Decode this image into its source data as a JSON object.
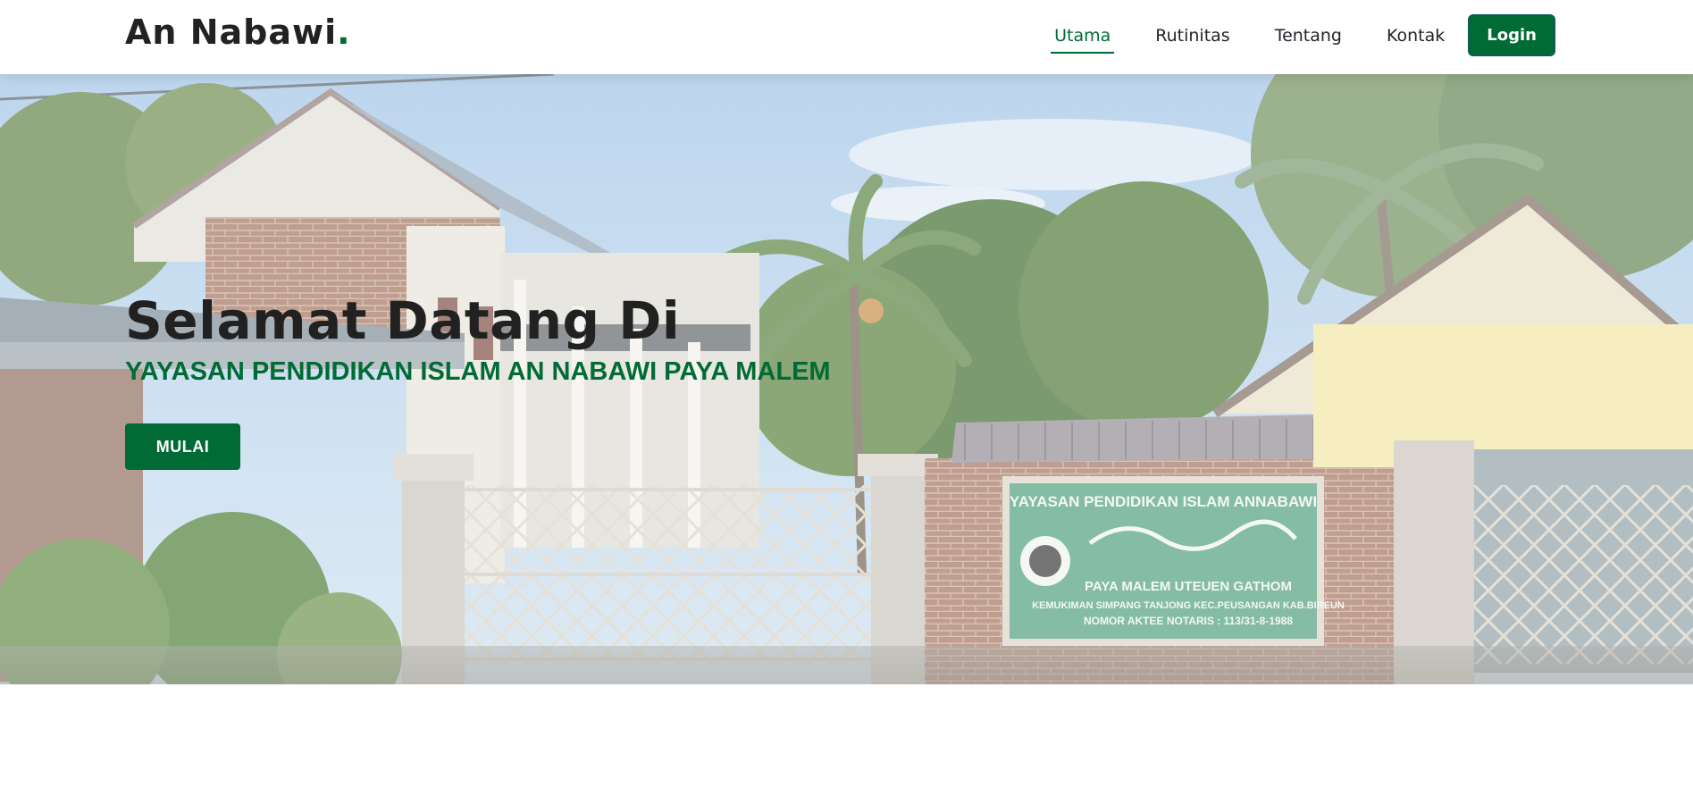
{
  "brand": {
    "name": "An Nabawi",
    "dot": ".",
    "accent_color": "#016b35"
  },
  "nav": {
    "items": [
      {
        "label": "Utama",
        "active": true
      },
      {
        "label": "Rutinitas",
        "active": false
      },
      {
        "label": "Tentang",
        "active": false
      },
      {
        "label": "Kontak",
        "active": false
      }
    ],
    "login_label": "Login"
  },
  "hero": {
    "title": "Selamat Datang Di",
    "subtitle": "YAYASAN PENDIDIKAN ISLAM AN NABAWI PAYA MALEM",
    "button_label": "MULAI",
    "sign": {
      "line1": "YAYASAN PENDIDIKAN ISLAM ANNABAWI",
      "line2": "PAYA MALEM UTEUEN GATHOM",
      "line3": "KEMUKIMAN SIMPANG TANJONG KEC.PEUSANGAN KAB.BIREUN",
      "line4": "NOMOR AKTEE NOTARIS : 113/31-8-1988"
    }
  }
}
